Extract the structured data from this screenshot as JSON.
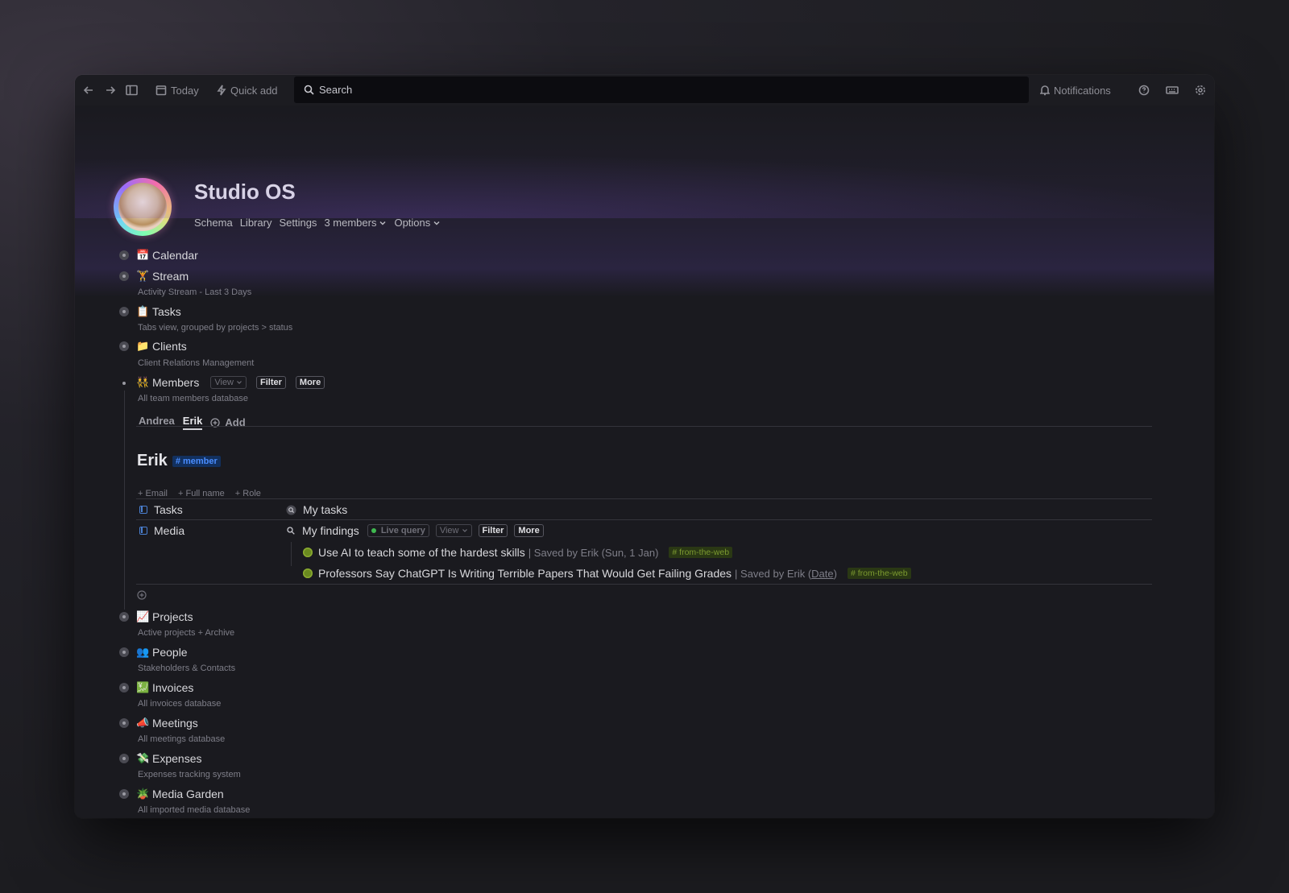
{
  "topbar": {
    "today": "Today",
    "quick_add": "Quick add",
    "search": "Search",
    "notifications": "Notifications"
  },
  "header": {
    "title": "Studio OS",
    "nav": [
      "Schema",
      "Library",
      "Settings",
      "3 members",
      "Options"
    ]
  },
  "items": [
    {
      "emoji": "📅",
      "label": "Calendar",
      "sub": ""
    },
    {
      "emoji": "🏋",
      "label": "Stream",
      "sub": "Activity Stream - Last 3 Days"
    },
    {
      "emoji": "📋",
      "label": "Tasks",
      "sub": "Tabs view,  grouped by projects > status"
    },
    {
      "emoji": "📁",
      "label": "Clients",
      "sub": "Client Relations Management"
    },
    {
      "emoji": "👯",
      "label": "Members",
      "sub": "All team members database"
    },
    {
      "emoji": "📈",
      "label": "Projects",
      "sub": "Active projects + Archive"
    },
    {
      "emoji": "👥",
      "label": "People",
      "sub": "Stakeholders & Contacts"
    },
    {
      "emoji": "💹",
      "label": "Invoices",
      "sub": "All invoices database"
    },
    {
      "emoji": "📣",
      "label": "Meetings",
      "sub": "All meetings database"
    },
    {
      "emoji": "💸",
      "label": "Expenses",
      "sub": "Expenses tracking system"
    },
    {
      "emoji": "🪴",
      "label": "Media Garden",
      "sub": "All imported media database"
    }
  ],
  "members_controls": {
    "view": "View",
    "filter": "Filter",
    "more": "More"
  },
  "member_tabs": [
    "Andrea",
    "Erik",
    "Add"
  ],
  "member": {
    "name": "Erik",
    "tag": "# member",
    "add_props": [
      "+ Email",
      "+ Full name",
      "+ Role"
    ],
    "props": [
      {
        "name": "Tasks",
        "value": "My tasks"
      },
      {
        "name": "Media",
        "value": "My findings"
      }
    ],
    "query": {
      "live": "Live query",
      "view": "View",
      "filter": "Filter",
      "more": "More"
    },
    "findings": [
      {
        "title": "Use AI to teach some of the hardest skills",
        "meta": "| Saved by Erik (Sun, 1 Jan)",
        "meta_link": "",
        "meta_end": "",
        "tag": "# from-the-web"
      },
      {
        "title": "Professors Say ChatGPT Is Writing Terrible Papers That Would Get Failing Grades",
        "meta": "| Saved by Erik (",
        "meta_link": "Date",
        "meta_end": ")",
        "tag": "# from-the-web"
      }
    ]
  }
}
